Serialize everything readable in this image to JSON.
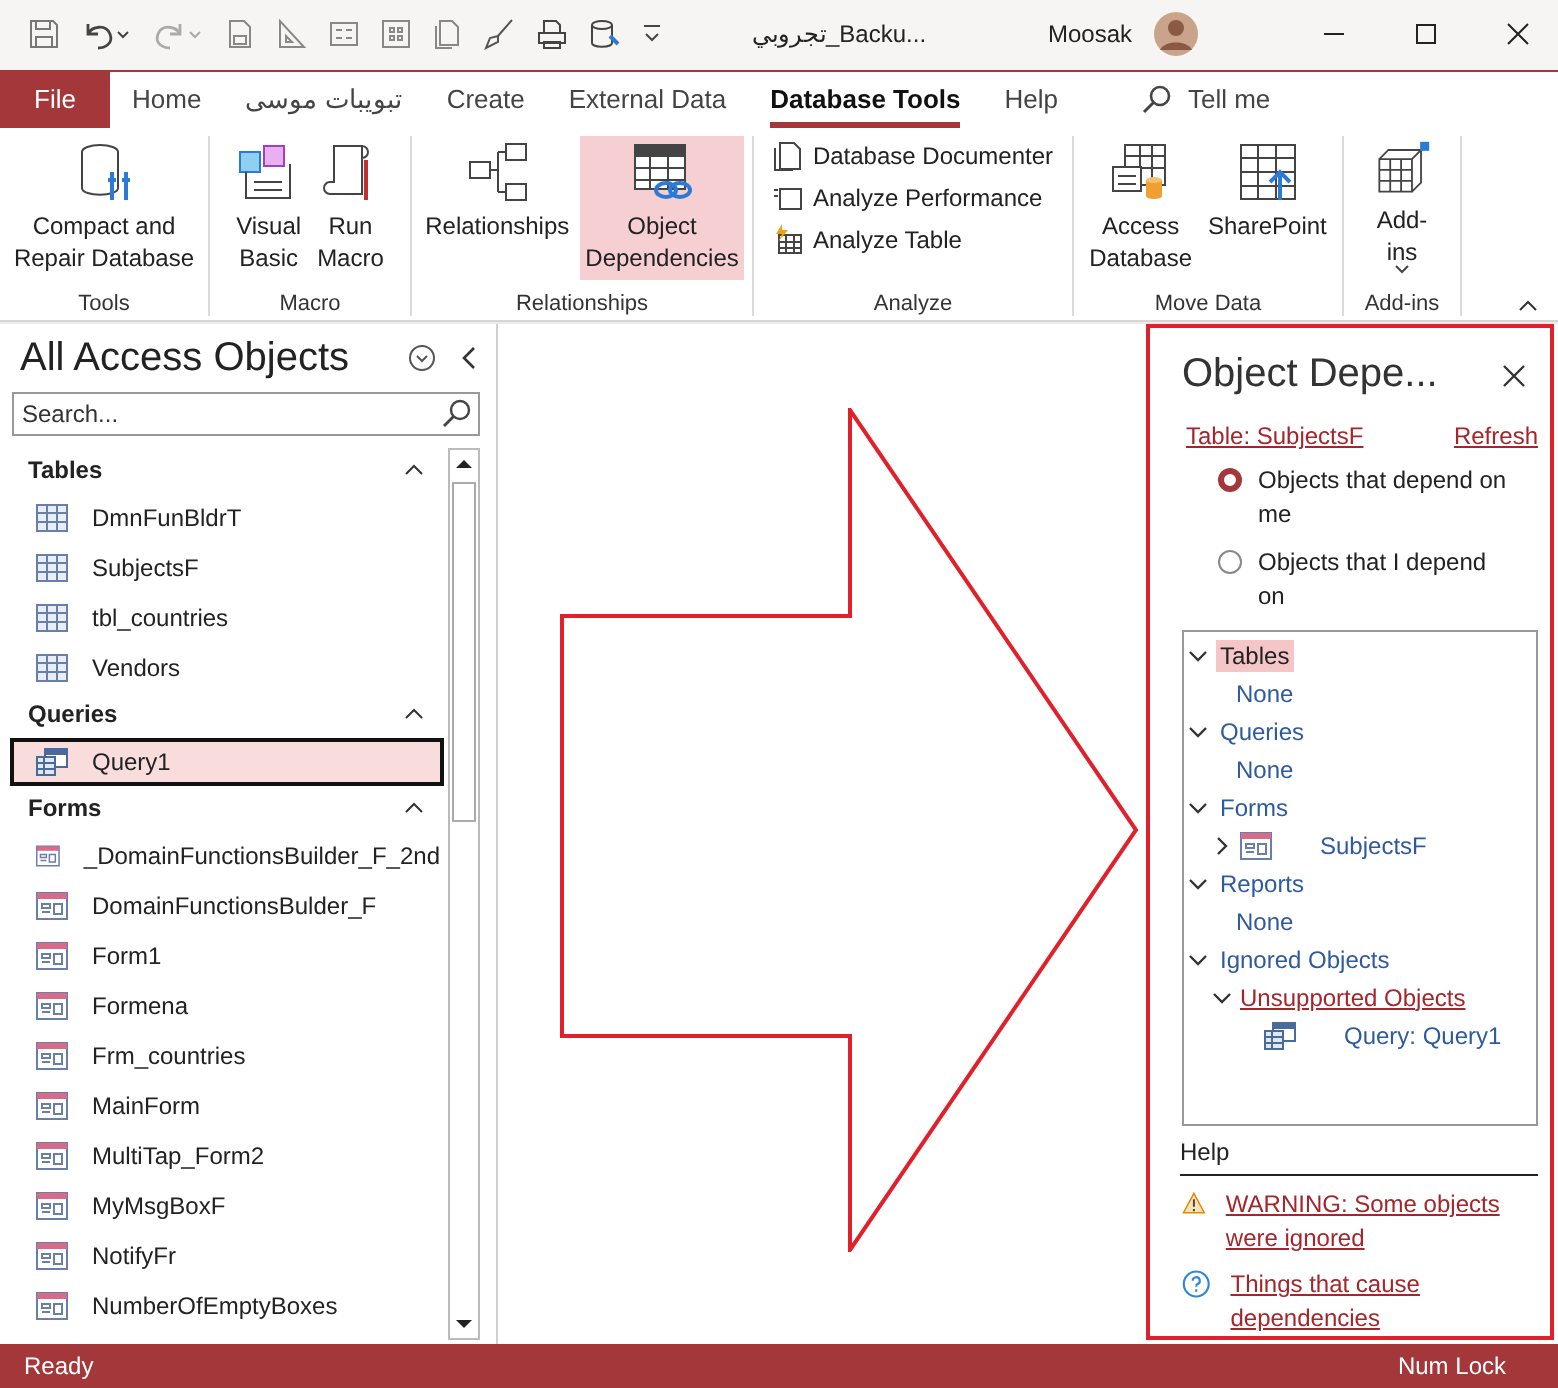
{
  "window": {
    "title": "تجروبي_Backu...",
    "user": "Moosak"
  },
  "tabs": [
    {
      "label": "File",
      "kind": "file",
      "selected": false
    },
    {
      "label": "Home",
      "kind": "tab",
      "selected": false
    },
    {
      "label": "تبويبات موسى",
      "kind": "tab",
      "selected": false
    },
    {
      "label": "Create",
      "kind": "tab",
      "selected": false
    },
    {
      "label": "External Data",
      "kind": "tab",
      "selected": false
    },
    {
      "label": "Database Tools",
      "kind": "tab",
      "selected": true
    },
    {
      "label": "Help",
      "kind": "tab",
      "selected": false
    }
  ],
  "tell_me": {
    "placeholder": "Tell me"
  },
  "ribbon": {
    "groups": [
      {
        "label": "Tools",
        "buttons": [
          {
            "label": "Compact and\nRepair Database",
            "kind": "large",
            "selected": false
          }
        ]
      },
      {
        "label": "Macro",
        "buttons": [
          {
            "label": "Visual\nBasic",
            "kind": "large",
            "selected": false
          },
          {
            "label": "Run\nMacro",
            "kind": "large",
            "selected": false
          }
        ]
      },
      {
        "label": "Relationships",
        "buttons": [
          {
            "label": "Relationships",
            "kind": "large",
            "selected": false
          },
          {
            "label": "Object\nDependencies",
            "kind": "large",
            "selected": true
          }
        ]
      },
      {
        "label": "Analyze",
        "buttons": [
          {
            "label": "Database Documenter",
            "kind": "small",
            "selected": false
          },
          {
            "label": "Analyze Performance",
            "kind": "small",
            "selected": false
          },
          {
            "label": "Analyze Table",
            "kind": "small",
            "selected": false
          }
        ]
      },
      {
        "label": "Move Data",
        "buttons": [
          {
            "label": "Access\nDatabase",
            "kind": "large",
            "selected": false
          },
          {
            "label": "SharePoint",
            "kind": "large",
            "selected": false
          }
        ]
      },
      {
        "label": "Add-ins",
        "buttons": [
          {
            "label": "Add-\nins",
            "kind": "large",
            "selected": false,
            "dropdown": true
          }
        ]
      }
    ]
  },
  "nav_pane": {
    "title": "All Access Objects",
    "search": {
      "placeholder": "Search..."
    },
    "groups": [
      {
        "label": "Tables",
        "kind": "table",
        "expanded": true,
        "items": [
          {
            "label": "DmnFunBldrT",
            "selected": false
          },
          {
            "label": "SubjectsF",
            "selected": false
          },
          {
            "label": "tbl_countries",
            "selected": false
          },
          {
            "label": "Vendors",
            "selected": false
          }
        ]
      },
      {
        "label": "Queries",
        "kind": "query",
        "expanded": true,
        "items": [
          {
            "label": "Query1",
            "selected": true
          }
        ]
      },
      {
        "label": "Forms",
        "kind": "form",
        "expanded": true,
        "items": [
          {
            "label": "_DomainFunctionsBuilder_F_2nd",
            "selected": false
          },
          {
            "label": "DomainFunctionsBulder_F",
            "selected": false
          },
          {
            "label": "Form1",
            "selected": false
          },
          {
            "label": "Formena",
            "selected": false
          },
          {
            "label": "Frm_countries",
            "selected": false
          },
          {
            "label": "MainForm",
            "selected": false
          },
          {
            "label": "MultiTap_Form2",
            "selected": false
          },
          {
            "label": "MyMsgBoxF",
            "selected": false
          },
          {
            "label": "NotifyFr",
            "selected": false
          },
          {
            "label": "NumberOfEmptyBoxes",
            "selected": false
          }
        ]
      }
    ]
  },
  "dependencies_pane": {
    "title": "Object Depe...",
    "object_link": "Table: SubjectsF",
    "refresh": "Refresh",
    "options": [
      {
        "label": "Objects that depend on me",
        "selected": true
      },
      {
        "label": "Objects that I depend on",
        "selected": false
      }
    ],
    "tree": [
      {
        "label": "Tables",
        "expanded": true,
        "selected": true,
        "children": [
          {
            "label": "None",
            "kind": "none"
          }
        ]
      },
      {
        "label": "Queries",
        "expanded": true,
        "selected": false,
        "children": [
          {
            "label": "None",
            "kind": "none"
          }
        ]
      },
      {
        "label": "Forms",
        "expanded": true,
        "selected": false,
        "children": [
          {
            "label": "SubjectsF",
            "kind": "form",
            "expanded": false
          }
        ]
      },
      {
        "label": "Reports",
        "expanded": true,
        "selected": false,
        "children": [
          {
            "label": "None",
            "kind": "none"
          }
        ]
      },
      {
        "label": "Ignored Objects",
        "expanded": true,
        "selected": false,
        "children": [
          {
            "label": "Unsupported Objects",
            "kind": "group",
            "expanded": true,
            "children": [
              {
                "label": "Query: Query1",
                "kind": "query"
              }
            ]
          }
        ]
      }
    ],
    "help_title": "Help",
    "help_links": [
      {
        "label": "WARNING: Some objects were ignored",
        "kind": "warning"
      },
      {
        "label": "Things that cause dependencies",
        "kind": "help"
      }
    ]
  },
  "status_bar": {
    "left": "Ready",
    "right": "Num Lock"
  }
}
